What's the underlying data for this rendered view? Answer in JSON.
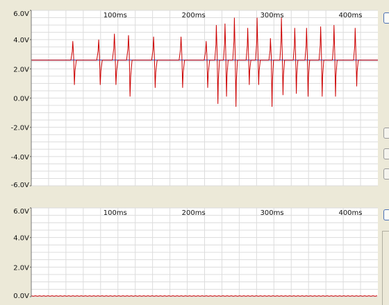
{
  "chart_data": [
    {
      "type": "line",
      "title": "",
      "xlabel": "",
      "ylabel": "",
      "xlim": [
        -7,
        435
      ],
      "ylim": [
        -6,
        6
      ],
      "x_ticks": [
        {
          "value": 100,
          "label": "100ms"
        },
        {
          "value": 200,
          "label": "200ms"
        },
        {
          "value": 300,
          "label": "300ms"
        },
        {
          "value": 400,
          "label": "400ms"
        }
      ],
      "y_ticks": [
        {
          "value": 6,
          "label": "6.0V"
        },
        {
          "value": 4,
          "label": "4.0V"
        },
        {
          "value": 2,
          "label": "2.0V"
        },
        {
          "value": 0,
          "label": "0.0V"
        },
        {
          "value": -2,
          "label": "-2.0V"
        },
        {
          "value": -4,
          "label": "-4.0V"
        },
        {
          "value": -6,
          "label": "-6.0V"
        }
      ],
      "grid": true,
      "baseline": {
        "value": 2.6,
        "color": "#2233aa"
      },
      "series": [
        {
          "color": "#cc0000",
          "spikes": [
            {
              "t": 47,
              "up": 1.3,
              "down": 1.7,
              "width": 7
            },
            {
              "t": 80,
              "up": 1.4,
              "down": 1.7,
              "width": 7
            },
            {
              "t": 100,
              "up": 1.8,
              "down": 1.7,
              "width": 7
            },
            {
              "t": 118,
              "up": 1.7,
              "down": 2.5,
              "width": 7
            },
            {
              "t": 150,
              "up": 1.6,
              "down": 1.9,
              "width": 7
            },
            {
              "t": 185,
              "up": 1.6,
              "down": 1.9,
              "width": 7
            },
            {
              "t": 217,
              "up": 1.3,
              "down": 1.9,
              "width": 7
            },
            {
              "t": 230,
              "up": 2.4,
              "down": 3.0,
              "width": 6
            },
            {
              "t": 241,
              "up": 2.5,
              "down": 2.5,
              "width": 6
            },
            {
              "t": 253,
              "up": 2.9,
              "down": 3.2,
              "width": 6
            },
            {
              "t": 270,
              "up": 2.2,
              "down": 1.7,
              "width": 6
            },
            {
              "t": 282,
              "up": 2.9,
              "down": 1.7,
              "width": 6
            },
            {
              "t": 299,
              "up": 1.5,
              "down": 3.2,
              "width": 6
            },
            {
              "t": 313,
              "up": 2.9,
              "down": 2.4,
              "width": 6
            },
            {
              "t": 330,
              "up": 2.2,
              "down": 2.3,
              "width": 6
            },
            {
              "t": 345,
              "up": 2.2,
              "down": 2.5,
              "width": 6
            },
            {
              "t": 363,
              "up": 2.3,
              "down": 2.5,
              "width": 6
            },
            {
              "t": 380,
              "up": 2.4,
              "down": 2.5,
              "width": 6
            },
            {
              "t": 407,
              "up": 2.2,
              "down": 1.8,
              "width": 6
            }
          ]
        }
      ]
    },
    {
      "type": "line",
      "title": "",
      "xlabel": "",
      "ylabel": "",
      "xlim": [
        -7,
        435
      ],
      "ylim": [
        0,
        6
      ],
      "x_ticks": [
        {
          "value": 100,
          "label": "100ms"
        },
        {
          "value": 200,
          "label": "200ms"
        },
        {
          "value": 300,
          "label": "300ms"
        },
        {
          "value": 400,
          "label": "400ms"
        }
      ],
      "y_ticks": [
        {
          "value": 6,
          "label": "6.0V"
        },
        {
          "value": 4,
          "label": "4.0V"
        },
        {
          "value": 2,
          "label": "2.0V"
        },
        {
          "value": 0,
          "label": "0.0V"
        }
      ],
      "grid": true,
      "series": [
        {
          "color": "#cc0000",
          "flat_value": 0.0
        }
      ]
    }
  ]
}
